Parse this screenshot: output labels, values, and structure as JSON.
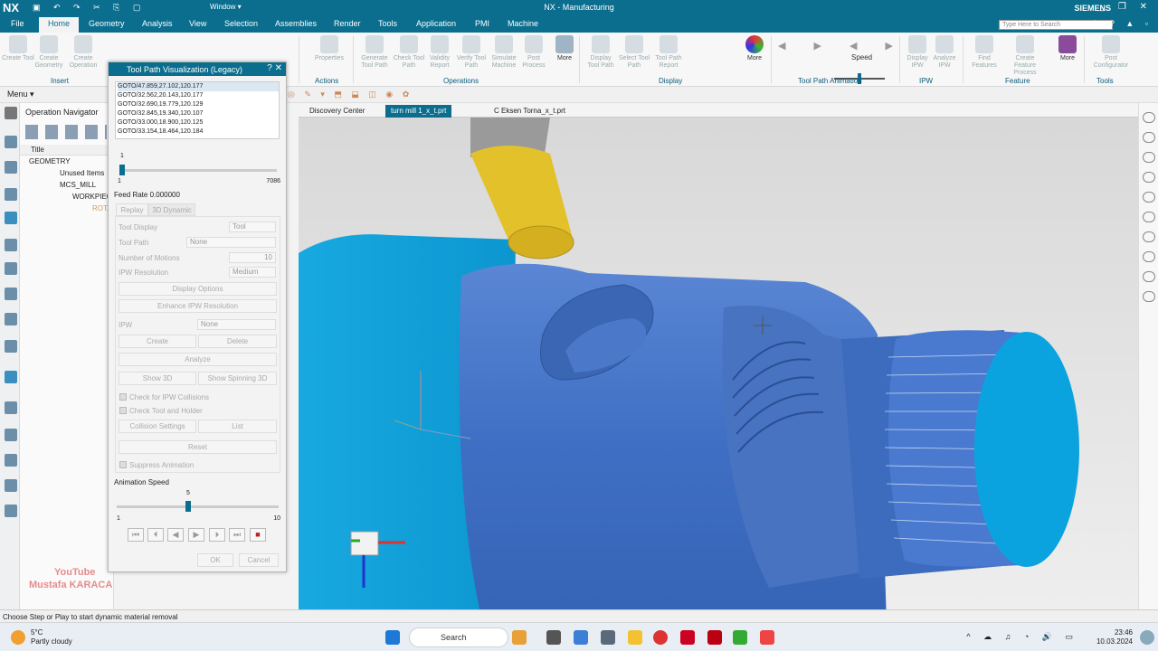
{
  "titlebar": {
    "logo": "NX",
    "title": "NX - Manufacturing",
    "window_menu": "Window ▾",
    "brand": "SIEMENS"
  },
  "menu": {
    "tabs": [
      "File",
      "Home",
      "Geometry",
      "Analysis",
      "View",
      "Selection",
      "Assemblies",
      "Render",
      "Tools",
      "Application",
      "PMI",
      "Machine"
    ],
    "search_placeholder": "Type Here to Search"
  },
  "ribbon": {
    "insert": [
      "Create Tool",
      "Create Geometry",
      "Create Operation"
    ],
    "actions": [
      "Properties"
    ],
    "operations": [
      "Generate Tool Path",
      "Check Tool Path",
      "Validity Report",
      "Verify Tool Path",
      "Simulate Machine",
      "Post Process",
      "More"
    ],
    "display": [
      "Display Tool Path",
      "Select Tool Path",
      "Tool Path Report",
      "More"
    ],
    "speed_label": "Speed",
    "ipw": [
      "Display IPW",
      "Analyze IPW"
    ],
    "feature": [
      "Find Features",
      "Create Feature Process",
      "More"
    ],
    "tools": [
      "Post Configurator"
    ],
    "groups": [
      "Insert",
      "Actions",
      "Operations",
      "Display",
      "Tool Path Animation",
      "IPW",
      "Feature",
      "Tools"
    ]
  },
  "secondary": {
    "menu": "Menu ▾"
  },
  "nav": {
    "header": "Operation Navigator",
    "column": "Title",
    "tree": [
      "GEOMETRY",
      "Unused Items",
      "MCS_MILL",
      "WORKPIECE",
      "ROTA"
    ]
  },
  "dialog": {
    "title": "Tool Path Visualization (Legacy)",
    "goto": [
      "GOTO/47.859,27.102,120.177",
      "GOTO/32.562,20.143,120.177",
      "GOTO/32.690,19.779,120.129",
      "GOTO/32.845,19.340,120.107",
      "GOTO/33.000,18.900,120.125",
      "GOTO/33.154,18.464,120.184"
    ],
    "motion_current": "1",
    "motion_min": "1",
    "motion_max": "7086",
    "motion_position": 0.0,
    "feed_rate": "Feed Rate 0.000000",
    "tabs": [
      "Replay",
      "3D Dynamic"
    ],
    "tool_display_label": "Tool Display",
    "tool_display_value": "Tool",
    "tool_path_label": "Tool Path",
    "tool_path_value": "None",
    "motions_label": "Number of Motions",
    "motions_value": "10",
    "ipw_res_label": "IPW Resolution",
    "ipw_res_value": "Medium",
    "display_options": "Display Options",
    "enhance": "Enhance IPW Resolution",
    "ipw_label": "IPW",
    "ipw_value": "None",
    "create": "Create",
    "delete": "Delete",
    "analyze": "Analyze",
    "show3d": "Show 3D",
    "show_spin": "Show Spinning 3D",
    "check_ipw": "Check for IPW Collisions",
    "check_tool": "Check Tool and Holder",
    "collision": "Collision Settings",
    "list": "List",
    "reset": "Reset",
    "suppress": "Suppress Animation",
    "anim_label": "Animation Speed",
    "anim_value": "5",
    "anim_min": "1",
    "anim_max": "10",
    "anim_position": 0.44,
    "ok": "OK",
    "cancel": "Cancel"
  },
  "doc_tabs": [
    "Discovery Center",
    "turn mill 1_x_t.prt",
    "C Eksen Torna_x_t.prt"
  ],
  "status": "Choose Step or Play to start dynamic material removal",
  "watermark": [
    "YouTube",
    "Mustafa KARACA"
  ],
  "taskbar": {
    "temp": "5°C",
    "weather": "Partly cloudy",
    "search": "Search",
    "time": "23:46",
    "date": "10.03.2024"
  },
  "colors": {
    "accent": "#0b6e8e",
    "part_blue": "#3f74c9",
    "stock_cyan": "#0aa3d8",
    "tool_yellow": "#e3c12a"
  }
}
